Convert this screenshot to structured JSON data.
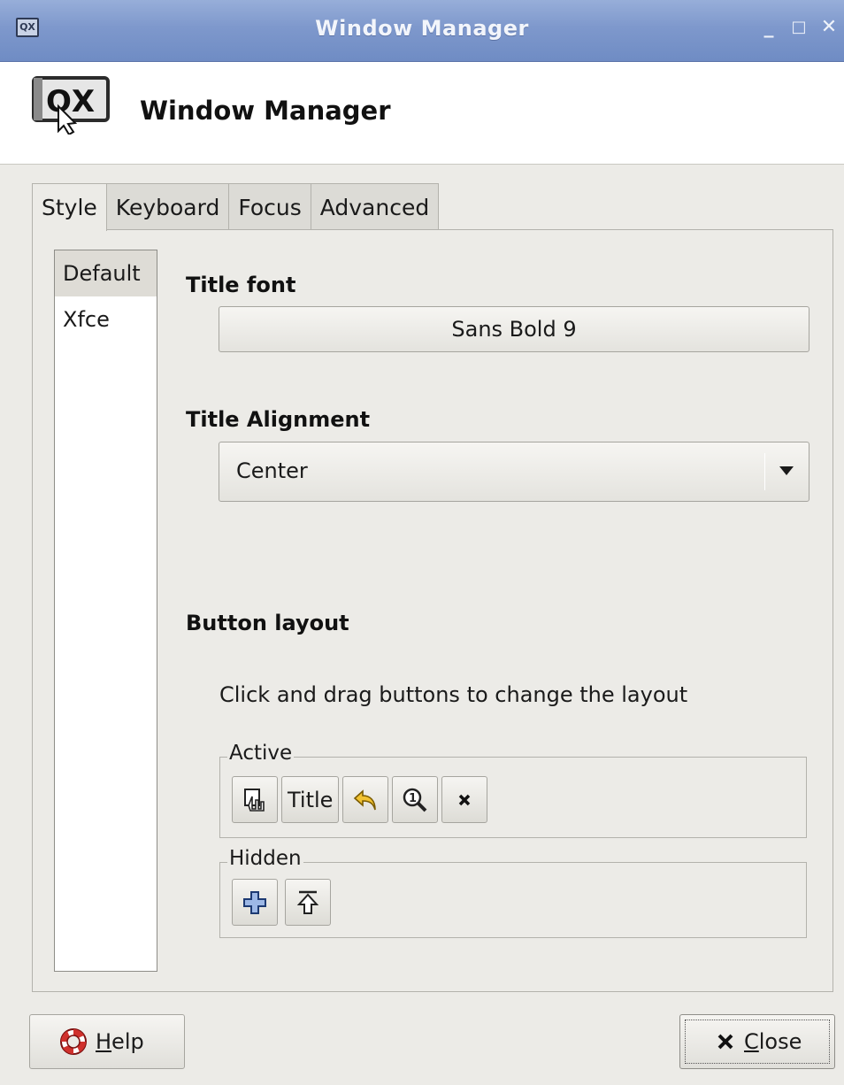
{
  "window": {
    "title": "Window Manager",
    "app_icon_text": "QX",
    "controls": [
      "minimize-icon",
      "maximize-icon",
      "close-icon"
    ]
  },
  "header": {
    "title": "Window Manager",
    "logo_text": "QX"
  },
  "tabs": [
    {
      "label": "Style",
      "active": true
    },
    {
      "label": "Keyboard",
      "active": false
    },
    {
      "label": "Focus",
      "active": false
    },
    {
      "label": "Advanced",
      "active": false
    }
  ],
  "themes": [
    {
      "name": "Default",
      "selected": true
    },
    {
      "name": "Xfce",
      "selected": false
    }
  ],
  "style": {
    "title_font_label": "Title font",
    "title_font_value": "Sans Bold 9",
    "title_alignment_label": "Title Alignment",
    "title_alignment_value": "Center",
    "button_layout_label": "Button layout",
    "hint": "Click and drag buttons to change the layout",
    "active_label": "Active",
    "active_title_label": "Title",
    "hidden_label": "Hidden"
  },
  "footer": {
    "help_mnemonic": "H",
    "help_rest": "elp",
    "close_mnemonic": "C",
    "close_rest": "lose"
  },
  "colors": {
    "titlebar": "#7e98cc",
    "background": "#ecebe7"
  }
}
